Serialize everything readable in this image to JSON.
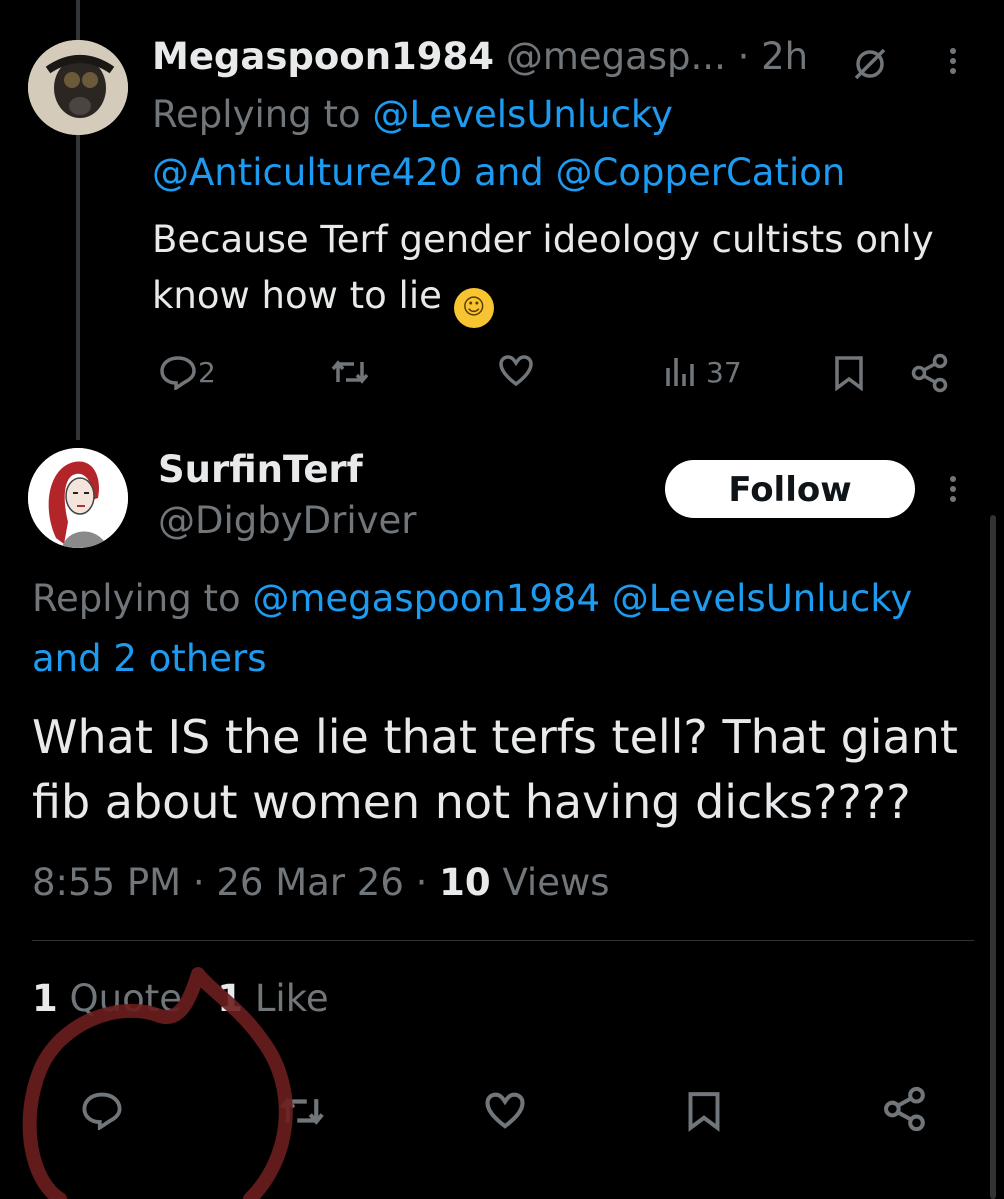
{
  "tweet1": {
    "display_name": "Megaspoon1984",
    "handle": "@megasp...",
    "time": "· 2h",
    "replying_prefix": "Replying to",
    "reply_to_1": "@LevelsUnlucky",
    "reply_to_2": "@Anticulture420",
    "reply_and": "and",
    "reply_to_3": "@CopperCation",
    "text": "Because Terf gender ideology cultists only know how to lie",
    "emoji_icon": "rolling-on-floor-laughing-emoji",
    "actions": {
      "reply_count": "2",
      "views_count": "37"
    }
  },
  "tweet2": {
    "display_name": "SurfinTerf",
    "handle": "@DigbyDriver",
    "follow_label": "Follow",
    "replying_prefix": "Replying to",
    "reply_to_1": "@megaspoon1984",
    "reply_to_2": "@LevelsUnlucky",
    "reply_others": "and 2 others",
    "text": "What IS the lie that terfs tell? That giant fib about women not having dicks????",
    "time": "8:55 PM",
    "date": "· 26 Mar 26 ·",
    "views_count": "10",
    "views_label": "Views",
    "quotes_count": "1",
    "quotes_label": "Quote",
    "likes_count": "1",
    "likes_label": "Like"
  },
  "colors": {
    "background": "#000000",
    "text": "#e7e9ea",
    "muted": "#71767b",
    "link": "#1d9bf0",
    "annotation": "#6b1e1e"
  }
}
